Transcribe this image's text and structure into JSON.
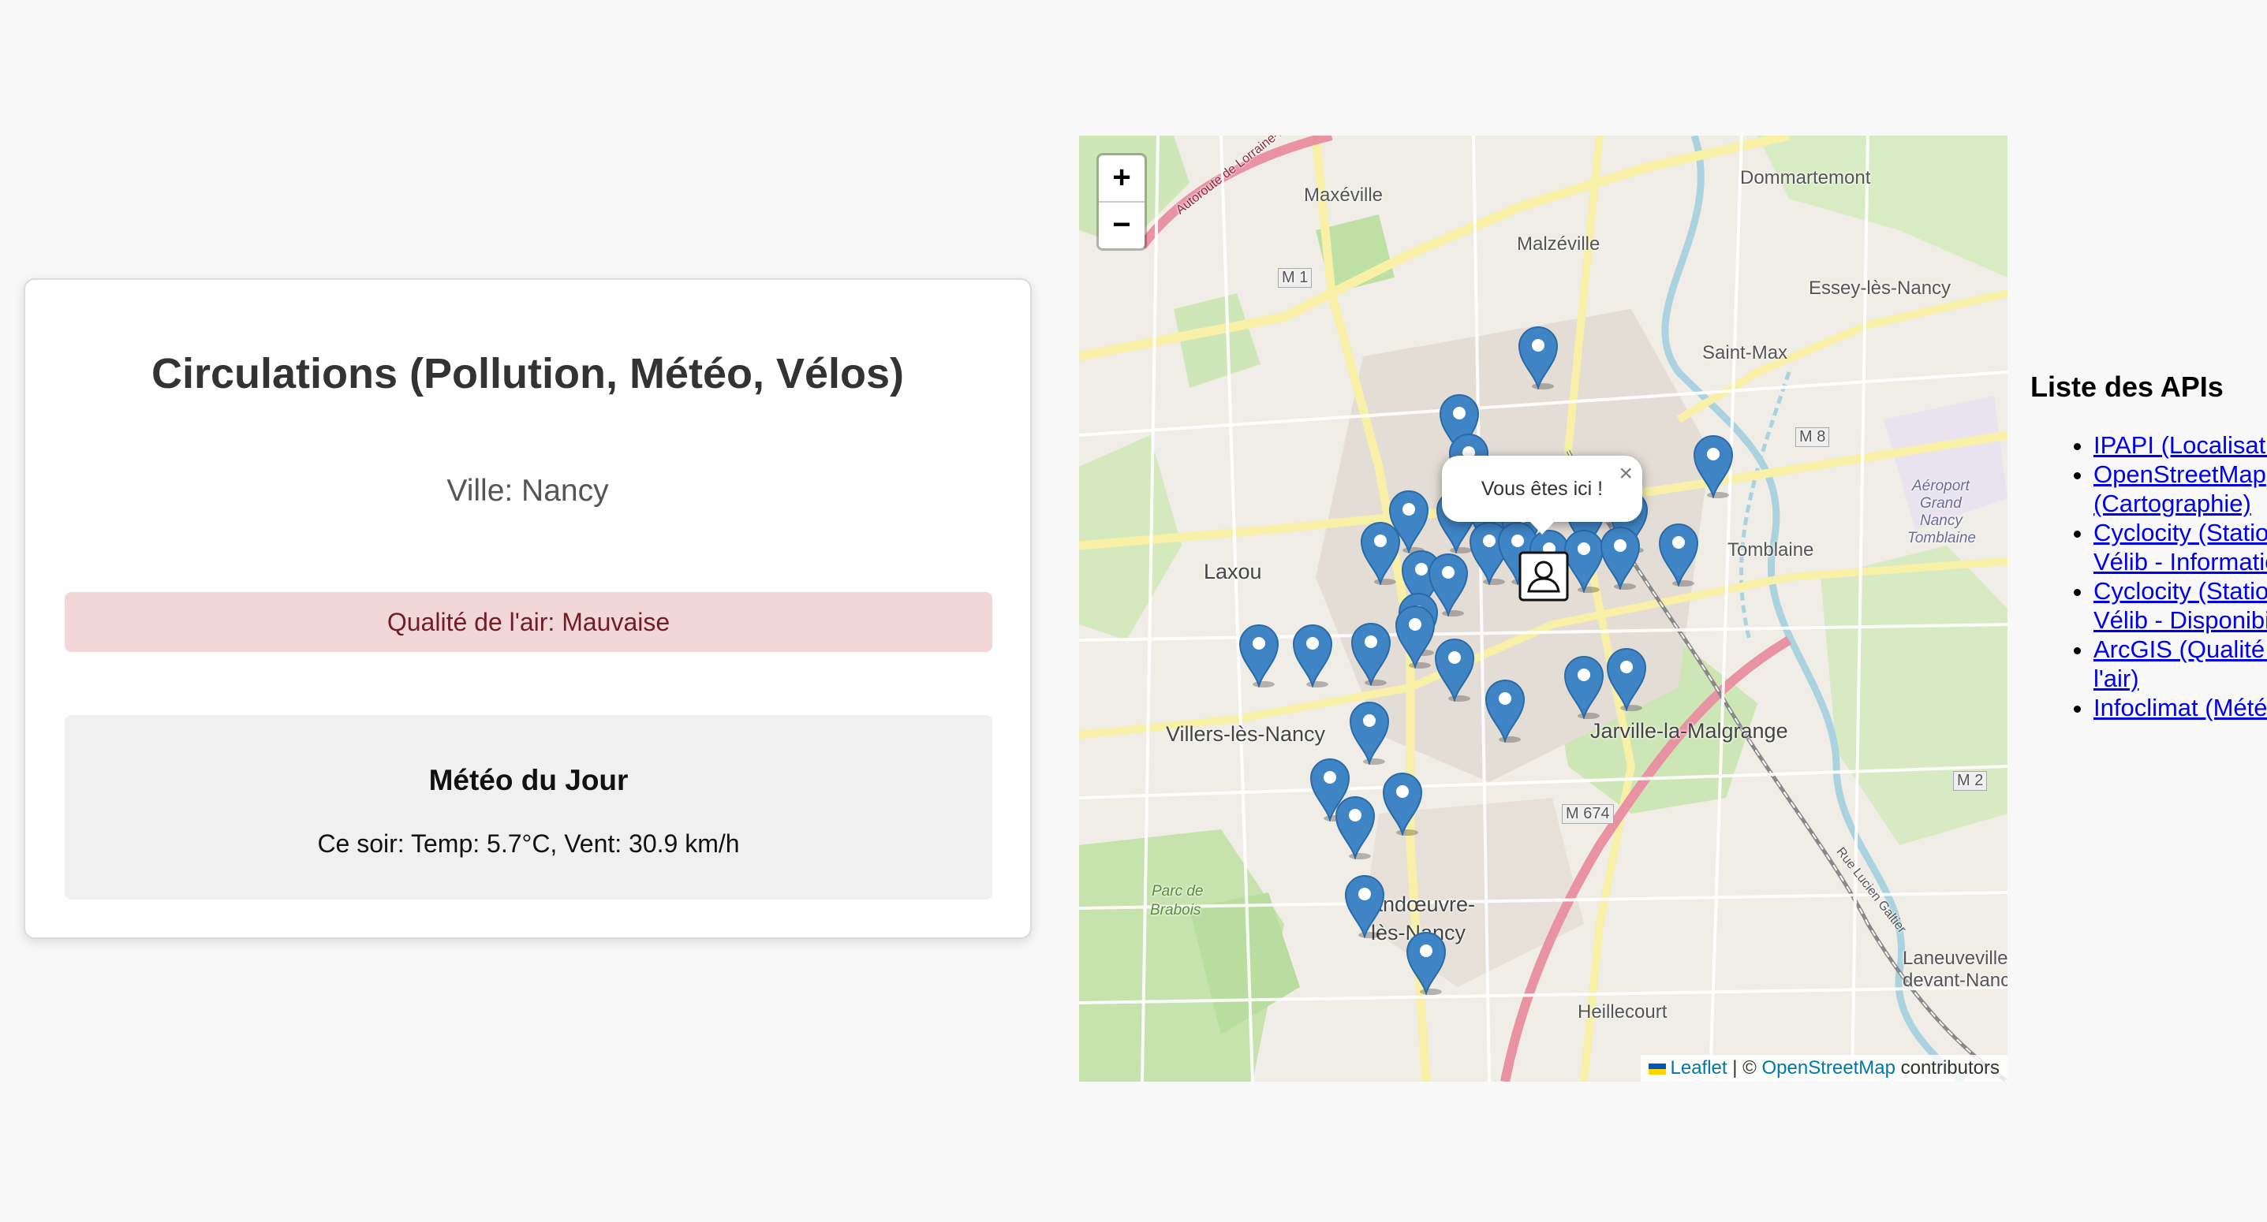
{
  "card": {
    "title": "Circulations (Pollution, Météo, Vélos)",
    "city": "Ville: Nancy",
    "air_quality": "Qualité de l'air: Mauvaise",
    "weather_title": "Météo du Jour",
    "weather_text": "Ce soir: Temp: 5.7°C, Vent: 30.9 km/h"
  },
  "map": {
    "zoom_in": "+",
    "zoom_out": "−",
    "popup_text": "Vous êtes ici !",
    "popup_close": "×",
    "labels": [
      "Maxéville",
      "Malzéville",
      "Dommartemont",
      "Essey-lès-Nancy",
      "Saint-Max",
      "Laxou",
      "Tomblaine",
      "Villers-lès-Nancy",
      "Jarville-la-Malgrange",
      "Vandœuvre-",
      "lès-Nancy",
      "Heillecourt",
      "Laneuveville",
      "devant-Nancy",
      "M 1",
      "M 8",
      "M 674",
      "M 2",
      "Parc de",
      "Brabois",
      "Aéroport",
      "Grand",
      "Nancy",
      "Tomblaine",
      "Autoroute de Lorraine-Bourgogne",
      "Rue Lucien Galtier"
    ],
    "attribution": {
      "leaflet": "Leaflet",
      "separator": "| ©",
      "osm": "OpenStreetMap",
      "contributors": "contributors"
    },
    "marker_color": "#3f84c4"
  },
  "apis": {
    "title": "Liste des APIs",
    "items": [
      {
        "label": "IPAPI (Localisation)"
      },
      {
        "label": "OpenStreetMap (Cartographie)"
      },
      {
        "label": "Cyclocity (Stations Vélib - Informations)"
      },
      {
        "label": "Cyclocity (Stations Vélib - Disponibilités)"
      },
      {
        "label": "ArcGIS (Qualité de l'air)"
      },
      {
        "label": "Infoclimat (Météo)"
      }
    ]
  }
}
